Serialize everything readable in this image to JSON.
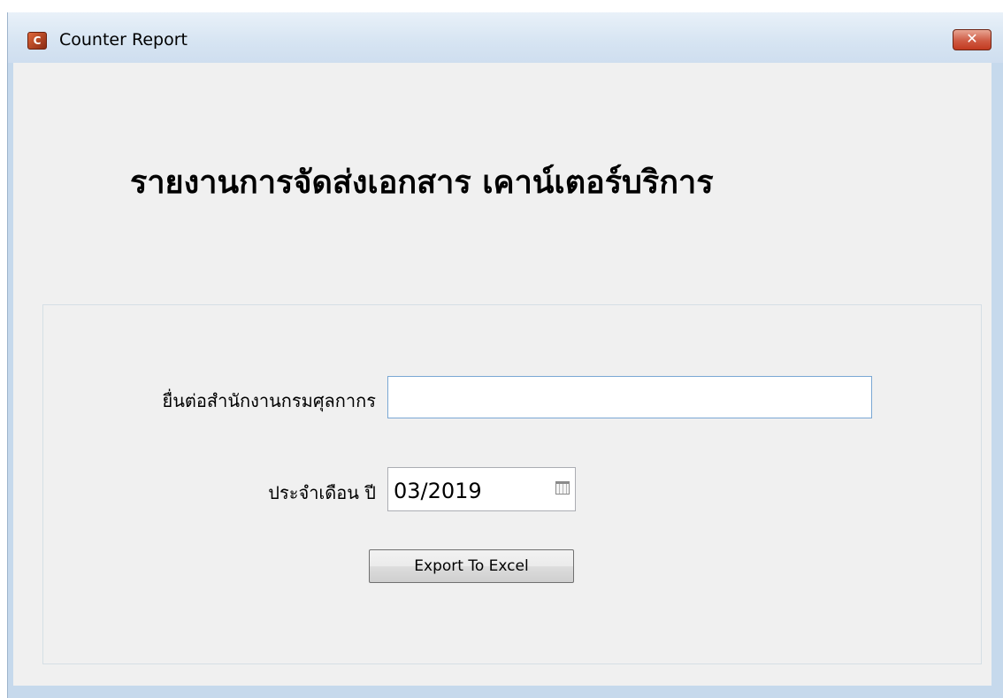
{
  "window": {
    "title": "Counter Report",
    "app_icon": "app-logo-icon",
    "close_label": "✕"
  },
  "form": {
    "heading": "รายงานการจัดส่งเอกสาร เคาน์เตอร์บริการ",
    "office_label": "ยื่นต่อสำนักงานกรมศุลกากร",
    "office_value": "",
    "month_label": "ประจำเดือน ปี",
    "month_value": "03/2019",
    "calendar_icon": "calendar-icon",
    "export_label": "Export To Excel"
  },
  "colors": {
    "frame": "#c6d9ec",
    "client_bg": "#f0f0f0",
    "close_button": "#c94a31",
    "input_focus_border": "#7aa7d4"
  }
}
